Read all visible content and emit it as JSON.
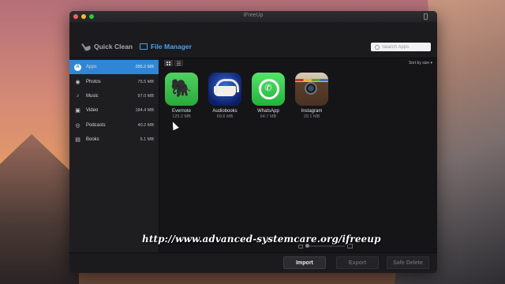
{
  "window": {
    "title": "iFreeUp"
  },
  "toolbar": {
    "quick_clean_label": "Quick Clean",
    "file_manager_label": "File Manager",
    "search_placeholder": "Search Apps"
  },
  "sidebar": {
    "items": [
      {
        "label": "Apps",
        "size": "286.2 MB",
        "icon": "apps-icon",
        "active": true
      },
      {
        "label": "Photos",
        "size": "75.5 MB",
        "icon": "camera-icon",
        "active": false
      },
      {
        "label": "Music",
        "size": "97.0 MB",
        "icon": "music-note-icon",
        "active": false
      },
      {
        "label": "Video",
        "size": "184.4 MB",
        "icon": "film-icon",
        "active": false
      },
      {
        "label": "Podcasts",
        "size": "40.2 MB",
        "icon": "podcast-icon",
        "active": false
      },
      {
        "label": "Books",
        "size": "6.1 MB",
        "icon": "book-icon",
        "active": false
      }
    ]
  },
  "main": {
    "sort_label": "Sort by size ▾",
    "apps": [
      {
        "name": "Evernote",
        "size": "125.2 MB",
        "icon": "evernote-icon"
      },
      {
        "name": "Audiobooks",
        "size": "69.6 MB",
        "icon": "audiobooks-icon"
      },
      {
        "name": "WhatsApp",
        "size": "64.7 MB",
        "icon": "whatsapp-icon"
      },
      {
        "name": "Instagram",
        "size": "29.1 MB",
        "icon": "instagram-icon"
      }
    ]
  },
  "footer": {
    "import_label": "Import",
    "export_label": "Export",
    "safe_delete_label": "Safe Delete"
  },
  "overlay": {
    "url": "http://www.advanced-systemcare.org/ifreeup"
  },
  "colors": {
    "accent": "#2f86d6",
    "window_bg": "#17171a"
  }
}
